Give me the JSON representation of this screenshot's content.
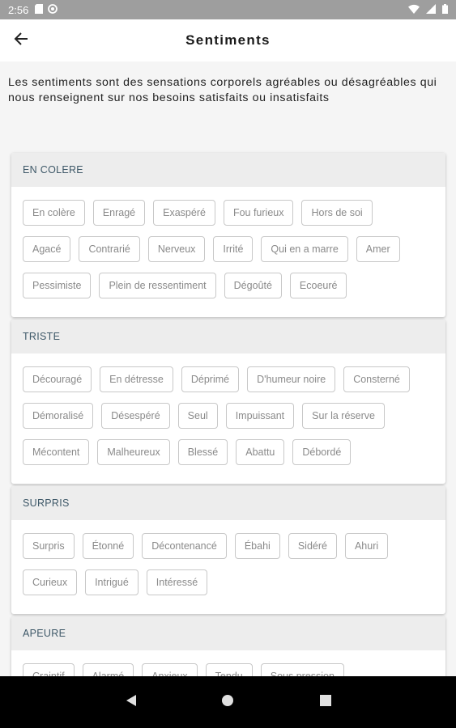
{
  "status_bar": {
    "time": "2:56",
    "icons_left": [
      "sd-card-icon",
      "notification-icon"
    ],
    "icons_right": [
      "wifi-icon",
      "signal-icon",
      "battery-icon"
    ]
  },
  "app_bar": {
    "title": "Sentiments",
    "back_icon": "arrow-left-icon"
  },
  "intro": "Les sentiments sont des sensations corporels agréables ou désagréables qui nous renseignent sur nos besoins satisfaits ou insatisfaits",
  "sections": [
    {
      "title": "EN COLERE",
      "chips": [
        "En colère",
        "Enragé",
        "Exaspéré",
        "Fou furieux",
        "Hors de soi",
        "Agacé",
        "Contrarié",
        "Nerveux",
        "Irrité",
        "Qui en a marre",
        "Amer",
        "Pessimiste",
        "Plein de ressentiment",
        "Dégoûté",
        "Ecoeuré"
      ]
    },
    {
      "title": "TRISTE",
      "chips": [
        "Découragé",
        "En détresse",
        "Déprimé",
        "D'humeur noire",
        "Consterné",
        "Démoralisé",
        "Désespéré",
        "Seul",
        "Impuissant",
        "Sur la réserve",
        "Mécontent",
        "Malheureux",
        "Blessé",
        "Abattu",
        "Débordé"
      ]
    },
    {
      "title": "SURPRIS",
      "chips": [
        "Surpris",
        "Étonné",
        "Décontenancé",
        "Ébahi",
        "Sidéré",
        "Ahuri",
        "Curieux",
        "Intrigué",
        "Intéressé"
      ]
    },
    {
      "title": "APEURE",
      "chips": [
        "Craintif",
        "Alarmé",
        "Anxieux",
        "Tendu",
        "Sous pression"
      ]
    }
  ],
  "nav_bar": {
    "icons": [
      "nav-back-icon",
      "nav-home-icon",
      "nav-recents-icon"
    ]
  }
}
